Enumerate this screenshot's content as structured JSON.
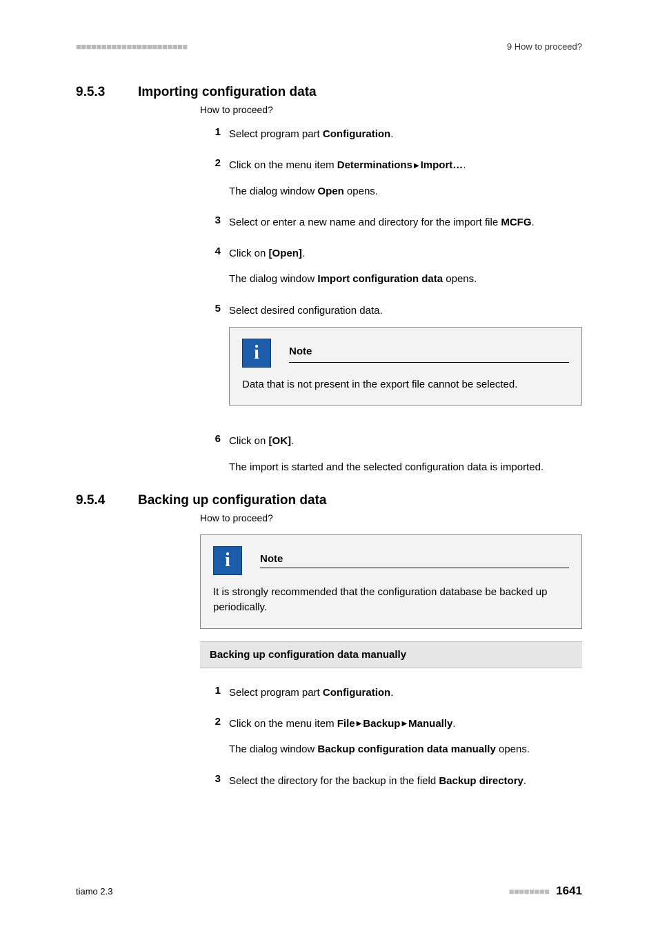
{
  "header": {
    "right": "9 How to proceed?"
  },
  "sec1": {
    "num": "9.5.3",
    "title": "Importing configuration data",
    "subtitle": "How to proceed?",
    "steps": {
      "s1_a": "Select program part ",
      "s1_b": "Configuration",
      "s1_c": ".",
      "s2_a": "Click on the menu item ",
      "s2_b": "Determinations",
      "s2_c": "Import…",
      "s2_d": ".",
      "s2_e1": "The dialog window ",
      "s2_e2": "Open",
      "s2_e3": " opens.",
      "s3_a": "Select or enter a new name and directory for the import file ",
      "s3_b": "MCFG",
      "s3_c": ".",
      "s4_a": "Click on ",
      "s4_b": "[Open]",
      "s4_c": ".",
      "s4_e1": "The dialog window ",
      "s4_e2": "Import configuration data",
      "s4_e3": " opens.",
      "s5_a": "Select desired configuration data.",
      "s6_a": "Click on ",
      "s6_b": "[OK]",
      "s6_c": ".",
      "s6_e": "The import is started and the selected configuration data is imported."
    },
    "note": {
      "label": "Note",
      "text": "Data that is not present in the export file cannot be selected."
    }
  },
  "sec2": {
    "num": "9.5.4",
    "title": "Backing up configuration data",
    "subtitle": "How to proceed?",
    "note": {
      "label": "Note",
      "text": "It is strongly recommended that the configuration database be backed up periodically."
    },
    "subhead": "Backing up configuration data manually",
    "steps": {
      "s1_a": "Select program part ",
      "s1_b": "Configuration",
      "s1_c": ".",
      "s2_a": "Click on the menu item ",
      "s2_b": "File",
      "s2_c": "Backup",
      "s2_d": "Manually",
      "s2_e": ".",
      "s2_f1": "The dialog window ",
      "s2_f2": "Backup configuration data manually",
      "s2_f3": " opens.",
      "s3_a": "Select the directory for the backup in the field ",
      "s3_b": "Backup directory",
      "s3_c": "."
    }
  },
  "footer": {
    "left": "tiamo 2.3",
    "page": "1641"
  }
}
